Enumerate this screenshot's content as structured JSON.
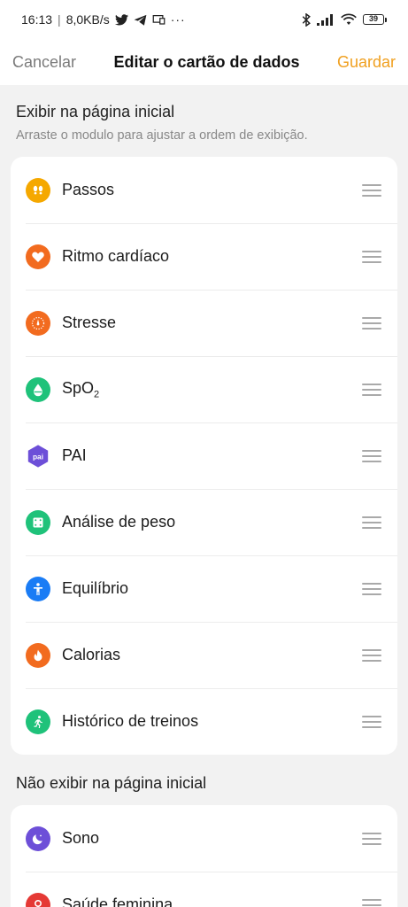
{
  "status_bar": {
    "time": "16:13",
    "net_speed": "8,0KB/s",
    "more": "···",
    "battery": "39"
  },
  "header": {
    "cancel": "Cancelar",
    "title": "Editar o cartão de dados",
    "save": "Guardar"
  },
  "shown": {
    "title": "Exibir na página inicial",
    "subtitle": "Arraste o modulo para ajustar a ordem de exibição.",
    "items": [
      {
        "label": "Passos",
        "icon": "footsteps-icon",
        "color": "#f5a800"
      },
      {
        "label": "Ritmo cardíaco",
        "icon": "heart-icon",
        "color": "#f26b1f"
      },
      {
        "label": "Stresse",
        "icon": "gauge-icon",
        "color": "#f26b1f"
      },
      {
        "label": "SpO",
        "sub": "2",
        "icon": "drop-icon",
        "color": "#1fc27a"
      },
      {
        "label": "PAI",
        "icon": "pai-icon",
        "color": "#6d4fd8"
      },
      {
        "label": "Análise de peso",
        "icon": "scale-icon",
        "color": "#1fc27a"
      },
      {
        "label": "Equilíbrio",
        "icon": "person-icon",
        "color": "#1a7cf5"
      },
      {
        "label": "Calorias",
        "icon": "flame-icon",
        "color": "#f26b1f"
      },
      {
        "label": "Histórico de treinos",
        "icon": "running-icon",
        "color": "#1fc27a"
      }
    ]
  },
  "hidden": {
    "title": "Não exibir na página inicial",
    "items": [
      {
        "label": "Sono",
        "icon": "moon-icon",
        "color": "#6d4fd8"
      },
      {
        "label": "Saúde feminina",
        "icon": "female-icon",
        "color": "#e53935"
      }
    ]
  },
  "colors": {
    "accent": "#f0a020",
    "background": "#f2f2f2"
  }
}
